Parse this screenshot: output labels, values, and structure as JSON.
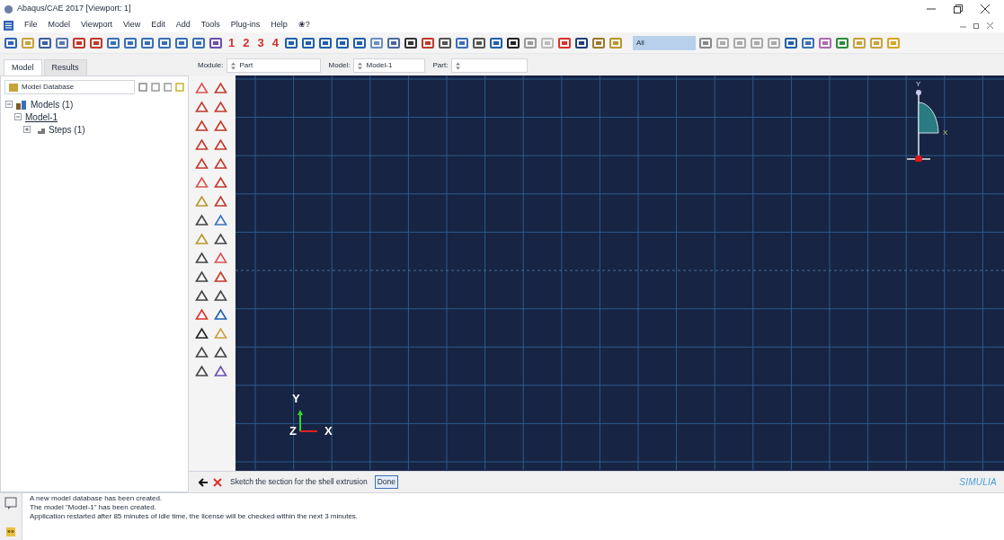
{
  "window": {
    "title": "Abaqus/CAE 2017 [Viewport: 1]"
  },
  "menu": [
    "File",
    "Model",
    "Viewport",
    "View",
    "Edit",
    "Add",
    "Tools",
    "Plug-ins",
    "Help",
    "❀?"
  ],
  "toolbar": {
    "view_numbers": [
      "1",
      "2",
      "3",
      "4"
    ],
    "selection_filter": "All"
  },
  "tabs": [
    {
      "label": "Model",
      "selected": true
    },
    {
      "label": "Results",
      "selected": false
    }
  ],
  "context": [
    {
      "label": "Module:",
      "value": "Part"
    },
    {
      "label": "Model:",
      "value": "Model-1"
    },
    {
      "label": "Part:"
    }
  ],
  "tree_selector": "Model Database",
  "tree": [
    {
      "label": "Models (1)",
      "expanded": true,
      "children": [
        {
          "label": "Model-1",
          "expanded": true,
          "children": [
            {
              "label": "Steps (1)",
              "expanded": false
            }
          ]
        }
      ]
    }
  ],
  "viewport": {
    "triad": {
      "y": "Y",
      "z": "Z",
      "x": "X"
    },
    "sketch_axes": {
      "y": "Y",
      "x": "X"
    }
  },
  "prompt": {
    "text": "Sketch the section for the shell extrusion",
    "button": "Done"
  },
  "brand": "SIMULIA",
  "messages": [
    "A new model database has been created.",
    "The model \"Model-1\" has been created.",
    "Application restarted after 85 minutes of idle time, the license will be checked within the next 3 minutes."
  ],
  "message_button": "»»"
}
